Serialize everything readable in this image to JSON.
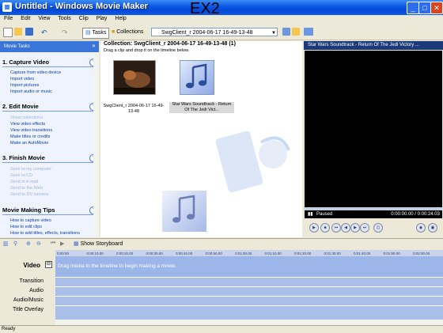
{
  "window": {
    "title": "Untitled - Windows Movie Maker",
    "overlay_label": "EX2",
    "controls": [
      "_",
      "□",
      "✕"
    ]
  },
  "menu": [
    "File",
    "Edit",
    "View",
    "Tools",
    "Clip",
    "Play",
    "Help"
  ],
  "toolbar": {
    "tasks_label": "Tasks",
    "collections_label": "Collections",
    "collection_selected": "SwgClient_r 2004-06-17 16-49-13-48"
  },
  "tasks_pane": {
    "header": "Movie Tasks",
    "sections": [
      {
        "title": "1. Capture Video",
        "links": [
          {
            "label": "Capture from video device",
            "enabled": true
          },
          {
            "label": "Import video",
            "enabled": true
          },
          {
            "label": "Import pictures",
            "enabled": true
          },
          {
            "label": "Import audio or music",
            "enabled": true
          }
        ]
      },
      {
        "title": "2. Edit Movie",
        "links": [
          {
            "label": "Show collections",
            "enabled": false
          },
          {
            "label": "View video effects",
            "enabled": true
          },
          {
            "label": "View video transitions",
            "enabled": true
          },
          {
            "label": "Make titles or credits",
            "enabled": true
          },
          {
            "label": "Make an AutoMovie",
            "enabled": true
          }
        ]
      },
      {
        "title": "3. Finish Movie",
        "links": [
          {
            "label": "Save to my computer",
            "enabled": false
          },
          {
            "label": "Save to CD",
            "enabled": false
          },
          {
            "label": "Send in e-mail",
            "enabled": false
          },
          {
            "label": "Send to the Web",
            "enabled": false
          },
          {
            "label": "Send to DV camera",
            "enabled": false
          }
        ]
      },
      {
        "title": "Movie Making Tips",
        "links": [
          {
            "label": "How to capture video",
            "enabled": true
          },
          {
            "label": "How to edit clips",
            "enabled": true
          },
          {
            "label": "How to add titles, effects, transitions",
            "enabled": true
          }
        ]
      }
    ]
  },
  "collection": {
    "title": "Collection: SwgClient_r 2004-06-17 16-49-13-48 (1)",
    "subtitle": "Drag a clip and drop it on the timeline below.",
    "items": [
      {
        "caption": "SwgClient_r 2004-06-17 16-49-13-48",
        "kind": "video"
      },
      {
        "caption": "Star Wars Soundtrack - Return Of The Jedi Vict...",
        "kind": "audio"
      }
    ]
  },
  "monitor": {
    "title": "Star Wars Soundtrack - Return Of The Jedi Victory ...",
    "status": "Paused",
    "time": "0:00:00.00 / 0:00:24.03"
  },
  "storyboard": {
    "toggle_label": "Show Storyboard"
  },
  "timeline": {
    "ruler_ticks": [
      "0:00:00",
      "0:00:10.00",
      "0:00:20.00",
      "0:00:30.00",
      "0:00:40.00",
      "0:00:50.00",
      "0:01:00.00",
      "0:01:10.00",
      "0:01:20.00",
      "0:01:30.00",
      "0:01:40.00",
      "0:01:50.00",
      "0:02:00.00"
    ],
    "tracks": [
      "Video",
      "Transition",
      "Audio",
      "Audio/Music",
      "Title Overlay"
    ],
    "drop_message": "Drag media to the timeline to begin making a movie."
  },
  "statusbar": {
    "text": "Ready"
  }
}
